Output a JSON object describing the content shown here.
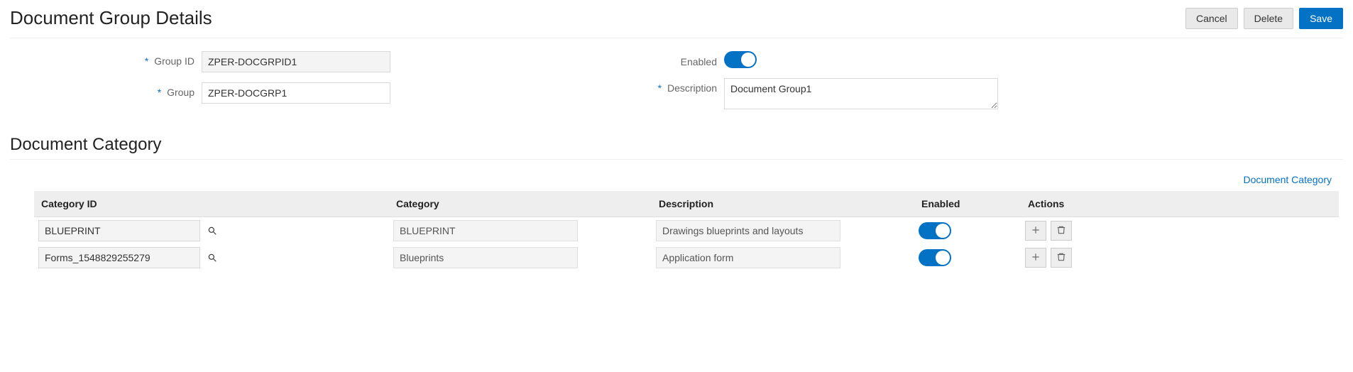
{
  "header": {
    "title": "Document Group Details",
    "cancel": "Cancel",
    "delete": "Delete",
    "save": "Save"
  },
  "form": {
    "group_id_label": "Group ID",
    "group_id_value": "ZPER-DOCGRPID1",
    "group_label": "Group",
    "group_value": "ZPER-DOCGRP1",
    "enabled_label": "Enabled",
    "enabled_on": true,
    "description_label": "Description",
    "description_value": "Document Group1"
  },
  "category_section": {
    "title": "Document Category",
    "link": "Document Category",
    "columns": {
      "id": "Category ID",
      "category": "Category",
      "description": "Description",
      "enabled": "Enabled",
      "actions": "Actions"
    },
    "rows": [
      {
        "id": "BLUEPRINT",
        "category": "BLUEPRINT",
        "description": "Drawings blueprints  and layouts",
        "enabled": true
      },
      {
        "id": "Forms_1548829255279",
        "category": "Blueprints",
        "description": "Application form",
        "enabled": true
      }
    ]
  }
}
